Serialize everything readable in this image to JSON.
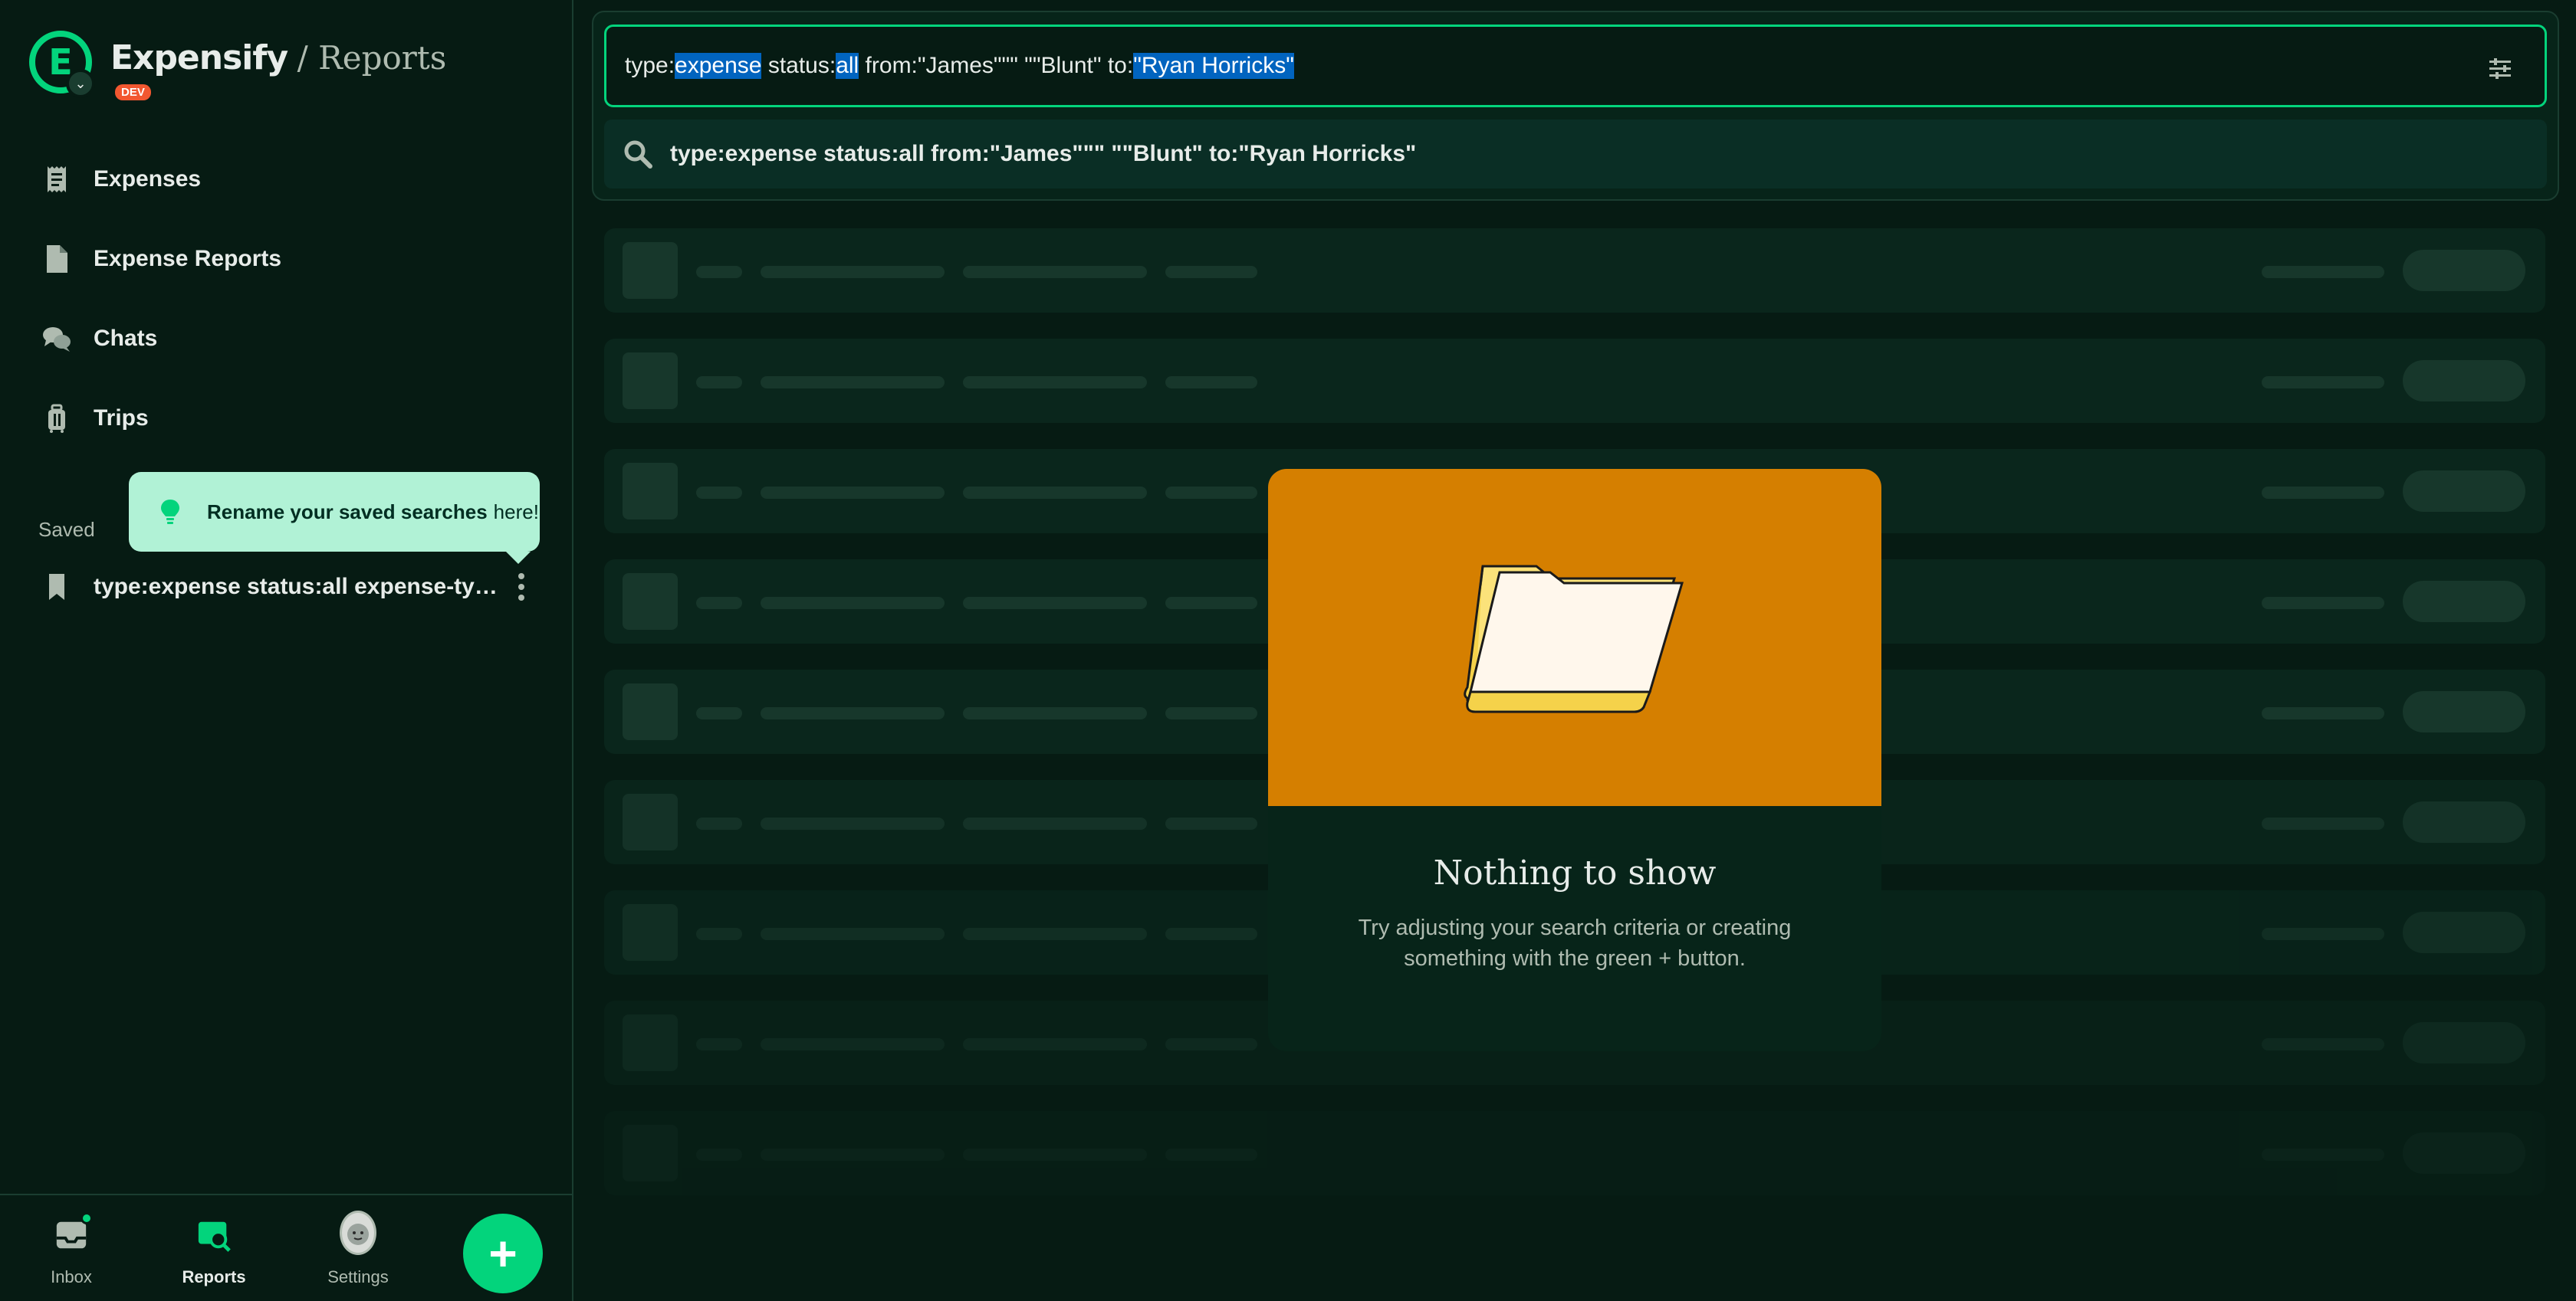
{
  "brand": {
    "logo_letter": "E",
    "name": "Expensify",
    "section": "/ Reports",
    "badge": "DEV"
  },
  "nav": {
    "items": [
      {
        "label": "Expenses",
        "icon": "receipt-icon"
      },
      {
        "label": "Expense Reports",
        "icon": "document-icon"
      },
      {
        "label": "Chats",
        "icon": "chat-bubbles-icon"
      },
      {
        "label": "Trips",
        "icon": "suitcase-icon"
      }
    ]
  },
  "saved": {
    "heading": "Saved",
    "item_label": "type:expense status:all expense-type:..."
  },
  "tooltip": {
    "strong": "Rename your saved searches",
    "rest": "here!"
  },
  "bottom_tabs": {
    "inbox": "Inbox",
    "reports": "Reports",
    "settings": "Settings",
    "fab": "+"
  },
  "search": {
    "query_parts": {
      "p1": "type:",
      "p2": "expense",
      "p3": " status:",
      "p4": "all",
      "p5": " from:\"James\"\"\" \"\"Blunt\" to:",
      "p6": "\"Ryan Horricks\""
    },
    "suggestion": "type:expense status:all from:\"James\"\"\" \"\"Blunt\" to:\"Ryan Horricks\""
  },
  "empty_state": {
    "title": "Nothing to show",
    "subtitle": "Try adjusting your search criteria or creating something with the green + button."
  },
  "colors": {
    "background": "#061b13",
    "accent": "#03d47c",
    "highlight": "#0164bf",
    "empty_hero": "#d57f00",
    "tooltip": "#b1f2d6"
  }
}
